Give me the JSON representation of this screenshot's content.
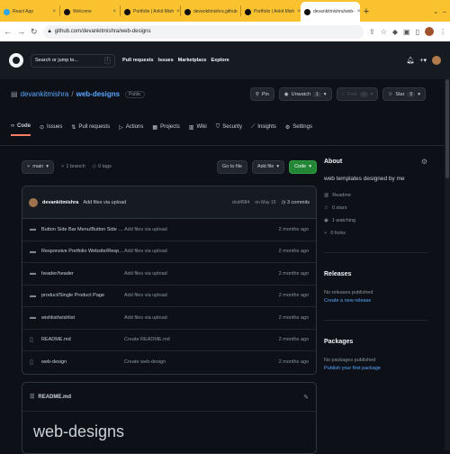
{
  "browser": {
    "tabs": [
      {
        "label": "React App",
        "color": "#2ea5e6"
      },
      {
        "label": "Welcome",
        "color": "#111111"
      },
      {
        "label": "Portfolio | Ankit Mish",
        "color": "#111111"
      },
      {
        "label": "devankitmishra.github",
        "color": "#111111"
      },
      {
        "label": "Portfolio | Ankit Mish",
        "color": "#111111"
      },
      {
        "label": "devankitmishra/web-",
        "color": "#111111"
      }
    ],
    "new_tab": "+",
    "url": "github.com/devankitmishra/web-designs"
  },
  "github": {
    "search_placeholder": "Search or jump to...",
    "search_key": "/",
    "nav": [
      "Pull requests",
      "Issues",
      "Marketplace",
      "Explore"
    ]
  },
  "repo": {
    "owner": "devankitmishra",
    "separator": "/",
    "name": "web-designs",
    "visibility": "Public",
    "pin": "Pin",
    "unwatch": "Unwatch",
    "unwatch_count": "1",
    "fork": "Fork",
    "fork_count": "0",
    "star": "Star",
    "star_count": "0",
    "tabs": [
      "Code",
      "Issues",
      "Pull requests",
      "Actions",
      "Projects",
      "Wiki",
      "Security",
      "Insights",
      "Settings"
    ]
  },
  "branch": {
    "name": "main",
    "branches": "1 branch",
    "tags": "0 tags",
    "goto_file": "Go to file",
    "add_file": "Add file",
    "code": "Code"
  },
  "commit": {
    "author": "devankitmishra",
    "message": "Add files via upload",
    "hash": "dcd4584",
    "date": "on May 15",
    "count": "3 commits"
  },
  "files": [
    {
      "type": "folder",
      "name": "Button Side Bar Menu/Button Side B...",
      "msg": "Add files via upload",
      "time": "2 months ago"
    },
    {
      "type": "folder",
      "name": "Responsive Portfolio Website/Respon...",
      "msg": "Add files via upload",
      "time": "2 months ago"
    },
    {
      "type": "folder",
      "name": "header/header",
      "msg": "Add files via upload",
      "time": "2 months ago"
    },
    {
      "type": "folder",
      "name": "product/Single Product Page",
      "msg": "Add files via upload",
      "time": "2 months ago"
    },
    {
      "type": "folder",
      "name": "wishlist/wishlist",
      "msg": "Add files via upload",
      "time": "2 months ago"
    },
    {
      "type": "file",
      "name": "README.md",
      "msg": "Create README.md",
      "time": "2 months ago"
    },
    {
      "type": "file",
      "name": "web-design",
      "msg": "Create web-design",
      "time": "2 months ago"
    }
  ],
  "readme": {
    "filename": "README.md",
    "heading": "web-designs"
  },
  "about": {
    "title": "About",
    "description": "web templates designed by me",
    "readme": "Readme",
    "stars": "0 stars",
    "watching": "1 watching",
    "forks": "0 forks"
  },
  "releases": {
    "title": "Releases",
    "none": "No releases published",
    "create": "Create a new release"
  },
  "packages": {
    "title": "Packages",
    "none": "No packages published",
    "publish": "Publish your first package"
  }
}
